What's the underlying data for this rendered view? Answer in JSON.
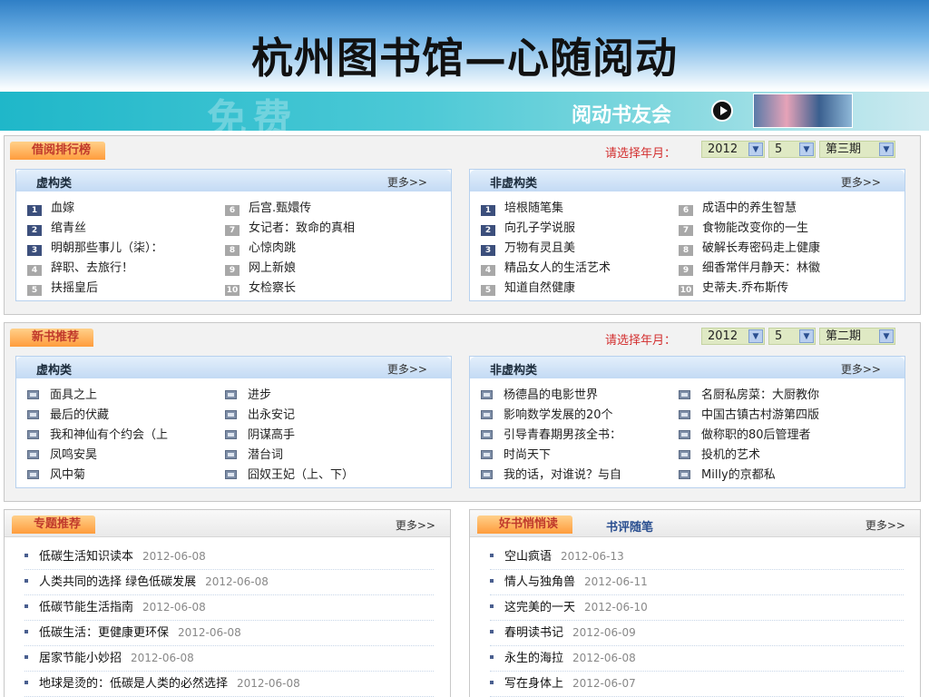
{
  "slide_title": "杭州图书馆—心随阅动",
  "banner": {
    "ghost_text": "免费",
    "club_label": "阅动书友会"
  },
  "ranking": {
    "tag": "借阅排行榜",
    "date_label": "请选择年月：",
    "year": "2012",
    "month": "5",
    "period": "第三期",
    "fiction": {
      "title": "虚构类",
      "more": "更多>>",
      "col1": [
        {
          "n": "1",
          "t": "血嫁"
        },
        {
          "n": "2",
          "t": "绾青丝"
        },
        {
          "n": "3",
          "t": "明朝那些事儿（柒）："
        },
        {
          "n": "4",
          "t": "辞职、去旅行！"
        },
        {
          "n": "5",
          "t": "扶摇皇后"
        }
      ],
      "col2": [
        {
          "n": "6",
          "t": "后宫.甄嬛传"
        },
        {
          "n": "7",
          "t": "女记者：致命的真相"
        },
        {
          "n": "8",
          "t": "心惊肉跳"
        },
        {
          "n": "9",
          "t": "网上新娘"
        },
        {
          "n": "10",
          "t": "女检察长"
        }
      ]
    },
    "nonfiction": {
      "title": "非虚构类",
      "more": "更多>>",
      "col1": [
        {
          "n": "1",
          "t": "培根随笔集"
        },
        {
          "n": "2",
          "t": "向孔子学说服"
        },
        {
          "n": "3",
          "t": "万物有灵且美"
        },
        {
          "n": "4",
          "t": "精品女人的生活艺术"
        },
        {
          "n": "5",
          "t": "知道自然健康"
        }
      ],
      "col2": [
        {
          "n": "6",
          "t": "成语中的养生智慧"
        },
        {
          "n": "7",
          "t": "食物能改变你的一生"
        },
        {
          "n": "8",
          "t": "破解长寿密码走上健康"
        },
        {
          "n": "9",
          "t": "细香常伴月静天：林徽"
        },
        {
          "n": "10",
          "t": "史蒂夫.乔布斯传"
        }
      ]
    }
  },
  "newbooks": {
    "tag": "新书推荐",
    "date_label": "请选择年月：",
    "year": "2012",
    "month": "5",
    "period": "第二期",
    "fiction": {
      "title": "虚构类",
      "more": "更多>>",
      "col1": [
        "面具之上",
        "最后的伏藏",
        "我和神仙有个约会（上",
        "凤鸣安昊",
        "风中菊"
      ],
      "col2": [
        "进步",
        "出永安记",
        "阴谋高手",
        "潜台词",
        "囧奴王妃（上、下）"
      ]
    },
    "nonfiction": {
      "title": "非虚构类",
      "more": "更多>>",
      "col1": [
        "杨德昌的电影世界",
        "影响数学发展的20个",
        "引导青春期男孩全书：",
        "时尚天下",
        "我的话，对谁说？与自"
      ],
      "col2": [
        "名厨私房菜：大厨教你",
        "中国古镇古村游第四版",
        "做称职的80后管理者",
        "投机的艺术",
        "Milly的京都私"
      ]
    }
  },
  "topics": {
    "tag": "专题推荐",
    "more": "更多>>",
    "items": [
      {
        "t": "低碳生活知识读本",
        "d": "2012-06-08"
      },
      {
        "t": "人类共同的选择 绿色低碳发展",
        "d": "2012-06-08"
      },
      {
        "t": "低碳节能生活指南",
        "d": "2012-06-08"
      },
      {
        "t": "低碳生活：更健康更环保",
        "d": "2012-06-08"
      },
      {
        "t": "居家节能小妙招",
        "d": "2012-06-08"
      },
      {
        "t": "地球是烫的：低碳是人类的必然选择",
        "d": "2012-06-08"
      }
    ]
  },
  "reviews": {
    "tag": "好书悄悄读",
    "tab2": "书评随笔",
    "more": "更多>>",
    "items": [
      {
        "t": "空山疯语",
        "d": "2012-06-13"
      },
      {
        "t": "情人与独角兽",
        "d": "2012-06-11"
      },
      {
        "t": "这完美的一天",
        "d": "2012-06-10"
      },
      {
        "t": "春明读书记",
        "d": "2012-06-09"
      },
      {
        "t": "永生的海拉",
        "d": "2012-06-08"
      },
      {
        "t": "写在身体上",
        "d": "2012-06-07"
      }
    ]
  }
}
